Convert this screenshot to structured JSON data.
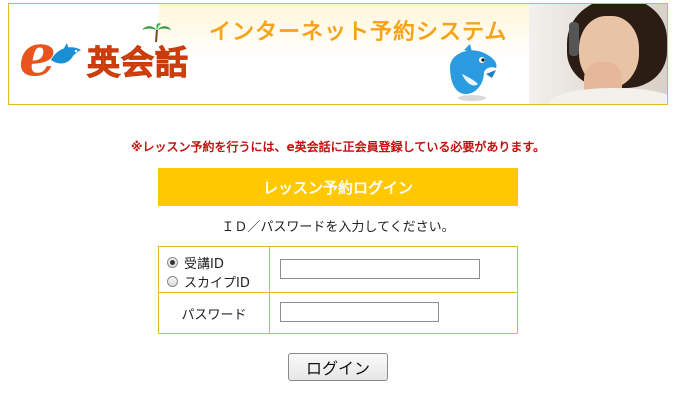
{
  "banner": {
    "logo_letter": "e",
    "logo_text": "英会話",
    "title": "インターネット予約システム"
  },
  "notice": "※レッスン予約を行うには、e英会話に正会員登録している必要があります。",
  "login": {
    "header": "レッスン予約ログイン",
    "instruction": "ＩＤ／パスワードを入力してください。",
    "id_type_options": [
      {
        "label": "受講ID",
        "selected": true
      },
      {
        "label": "スカイプID",
        "selected": false
      }
    ],
    "id_value": "",
    "password_label": "パスワード",
    "password_value": "",
    "submit_label": "ログイン"
  },
  "colors": {
    "accent": "#ffc800",
    "border": "#e3b92a",
    "notice": "#c0140f",
    "brand": "#e8541c"
  }
}
